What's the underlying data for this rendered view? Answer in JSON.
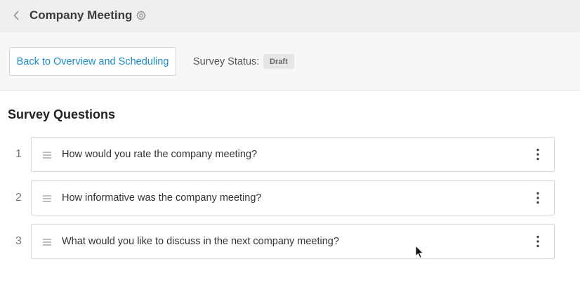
{
  "header": {
    "title": "Company Meeting",
    "back_icon": "chevron-left-icon",
    "settings_icon": "gear-icon"
  },
  "toolbar": {
    "back_button_label": "Back to Overview and Scheduling",
    "status_label": "Survey Status:",
    "status_value": "Draft"
  },
  "main": {
    "section_title": "Survey Questions",
    "questions": [
      {
        "number": "1",
        "text": "How would you rate the company meeting?"
      },
      {
        "number": "2",
        "text": "How informative was the company meeting?"
      },
      {
        "number": "3",
        "text": "What would you like to discuss in the next company meeting?"
      }
    ]
  },
  "colors": {
    "link": "#1a8bc8",
    "topbar": "#efefef",
    "subbar": "#f7f7f7",
    "badge": "#e6e6e6"
  }
}
